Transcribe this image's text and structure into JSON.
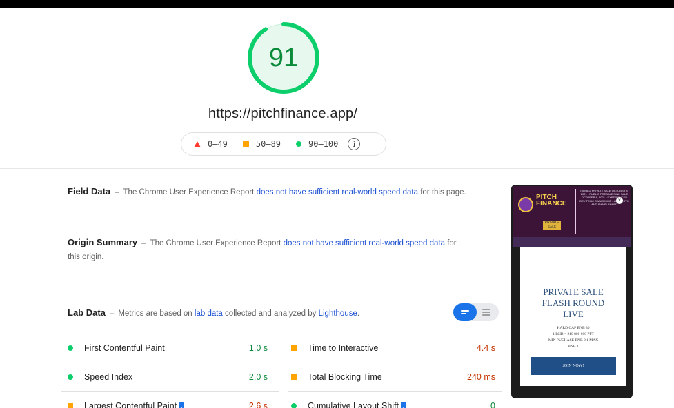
{
  "score": {
    "value": "91",
    "fraction": 0.91,
    "color": "#0cce6b"
  },
  "url": "https://pitchfinance.app/",
  "legend": {
    "low": "0–49",
    "mid": "50–89",
    "high": "90–100"
  },
  "field_data": {
    "title": "Field Data",
    "text_before": "The Chrome User Experience Report",
    "link": "does not have sufficient real-world speed data",
    "text_after": "for this page."
  },
  "origin_summary": {
    "title": "Origin Summary",
    "text_before": "The Chrome User Experience Report",
    "link": "does not have sufficient real-world speed data",
    "text_after": "for this origin."
  },
  "lab_data": {
    "title": "Lab Data",
    "text_before": "Metrics are based on",
    "link1": "lab data",
    "text_middle": "collected and analyzed by",
    "link2": "Lighthouse",
    "text_after": "."
  },
  "metrics": [
    {
      "label": "First Contentful Paint",
      "value": "1.0 s",
      "status": "good",
      "flag": false
    },
    {
      "label": "Time to Interactive",
      "value": "4.4 s",
      "status": "avg",
      "flag": false
    },
    {
      "label": "Speed Index",
      "value": "2.0 s",
      "status": "good",
      "flag": false
    },
    {
      "label": "Total Blocking Time",
      "value": "240 ms",
      "status": "avg",
      "flag": false
    },
    {
      "label": "Largest Contentful Paint",
      "value": "2.6 s",
      "status": "avg",
      "flag": true
    },
    {
      "label": "Cumulative Layout Shift",
      "value": "0",
      "status": "good",
      "flag": true
    }
  ],
  "screenshot": {
    "brand_line1": "PITCH",
    "brand_line2": "FINANCE",
    "ribbon": "PRIVATE SALE",
    "bullets": "• SMALL PRIVATE SALE OCTOBER 4, 2021 • PUBLIC PRESALE PINK SALE OCTOBER 6, 2021 • EXPERIENCED DEV TEAM OWNERSHIP • AUDIT, KYC AND AMA PLANNED",
    "title_line1": "PRIVATE SALE",
    "title_line2": "FLASH ROUND",
    "title_line3": "LIVE",
    "detail1": "HARD CAP BNB 30",
    "detail2": "1 BNB = 210 000 000 PFT",
    "detail3": "MIN PUCHASE BNB 0.1 MAX",
    "detail4": "BNB 1",
    "button": "JOIN NOW!"
  }
}
